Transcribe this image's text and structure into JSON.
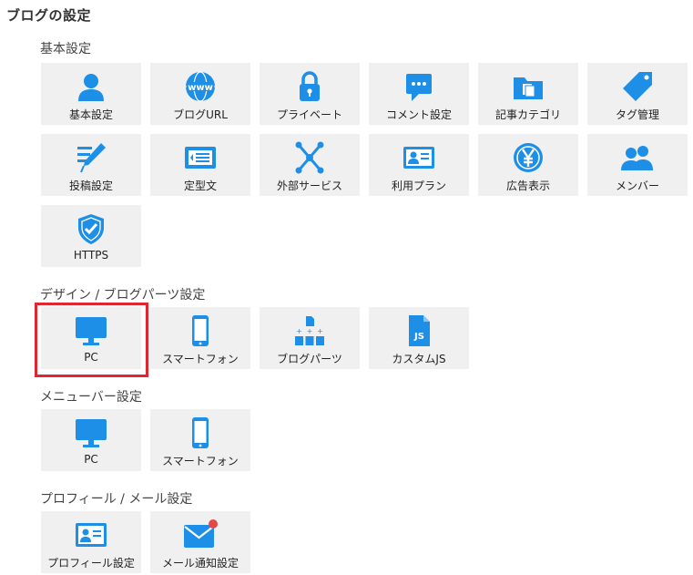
{
  "page_title": "ブログの設定",
  "accent_color": "#1e8fe6",
  "sections": {
    "basic": {
      "title": "基本設定",
      "items": [
        {
          "label": "基本設定",
          "icon": "user-icon"
        },
        {
          "label": "ブログURL",
          "icon": "www-globe-icon"
        },
        {
          "label": "プライベート",
          "icon": "lock-icon"
        },
        {
          "label": "コメント設定",
          "icon": "comment-icon"
        },
        {
          "label": "記事カテゴリ",
          "icon": "folder-icon"
        },
        {
          "label": "タグ管理",
          "icon": "tag-icon"
        },
        {
          "label": "投稿設定",
          "icon": "pencil-icon"
        },
        {
          "label": "定型文",
          "icon": "template-icon"
        },
        {
          "label": "外部サービス",
          "icon": "network-icon"
        },
        {
          "label": "利用プラン",
          "icon": "id-card-icon"
        },
        {
          "label": "広告表示",
          "icon": "yen-icon"
        },
        {
          "label": "メンバー",
          "icon": "members-icon"
        },
        {
          "label": "HTTPS",
          "icon": "shield-check-icon"
        }
      ]
    },
    "design": {
      "title": "デザイン / ブログパーツ設定",
      "items": [
        {
          "label": "PC",
          "icon": "monitor-icon",
          "highlighted": true
        },
        {
          "label": "スマートフォン",
          "icon": "smartphone-icon"
        },
        {
          "label": "ブログパーツ",
          "icon": "blog-parts-icon"
        },
        {
          "label": "カスタムJS",
          "icon": "js-file-icon"
        }
      ]
    },
    "menubar": {
      "title": "メニューバー設定",
      "items": [
        {
          "label": "PC",
          "icon": "monitor-icon"
        },
        {
          "label": "スマートフォン",
          "icon": "smartphone-icon"
        }
      ]
    },
    "profile": {
      "title": "プロフィール / メール設定",
      "items": [
        {
          "label": "プロフィール設定",
          "icon": "profile-card-icon"
        },
        {
          "label": "メール通知設定",
          "icon": "mail-notify-icon"
        }
      ]
    }
  }
}
